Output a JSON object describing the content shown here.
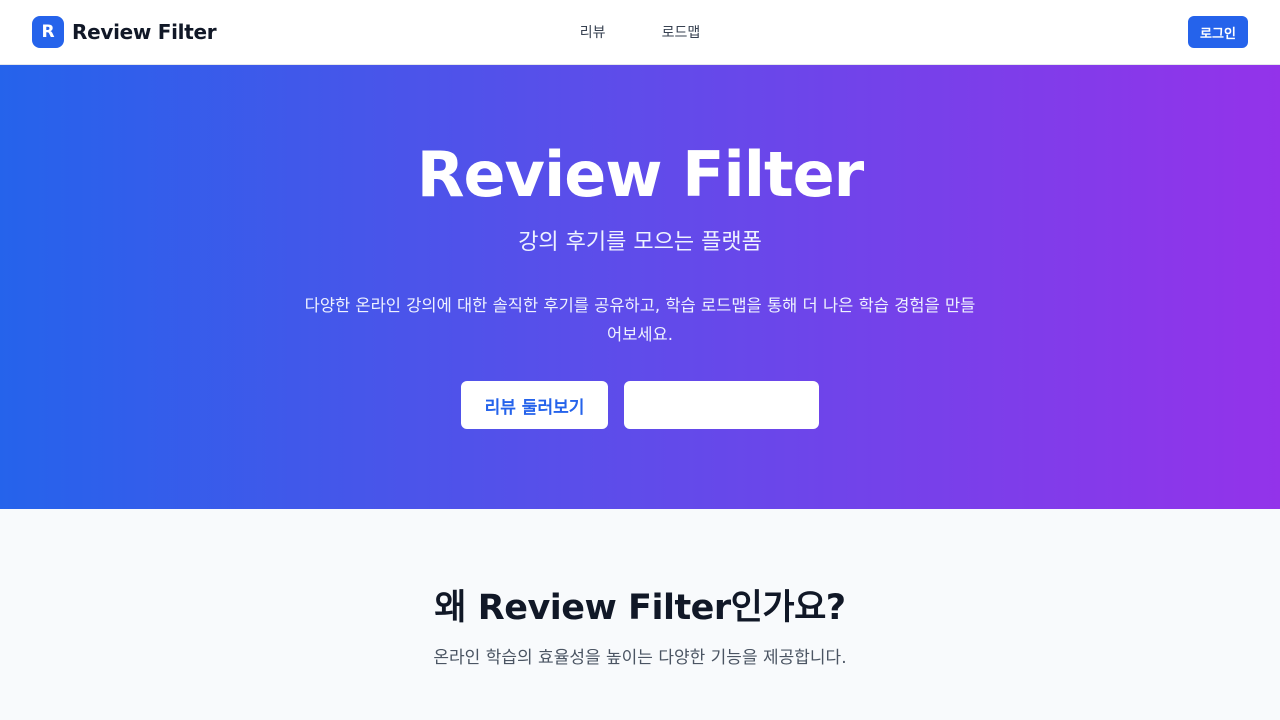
{
  "header": {
    "logo_letter": "R",
    "brand_name": "Review Filter",
    "nav": [
      {
        "label": "리뷰"
      },
      {
        "label": "로드맵"
      }
    ],
    "login_label": "로그인"
  },
  "hero": {
    "title": "Review Filter",
    "subtitle": "강의 후기를 모으는 플랫폼",
    "description": "다양한 온라인 강의에 대한 솔직한 후기를 공유하고, 학습 로드맵을 통해 더 나은 학습 경험을 만들어보세요.",
    "primary_button_label": "리뷰 둘러보기",
    "secondary_button_label": ""
  },
  "features": {
    "title": "왜 Review Filter인가요?",
    "subtitle": "온라인 학습의 효율성을 높이는 다양한 기능을 제공합니다."
  },
  "colors": {
    "primary": "#2563eb",
    "gradient_start": "#2563eb",
    "gradient_end": "#9333ea",
    "section_bg": "#f8fafc"
  }
}
